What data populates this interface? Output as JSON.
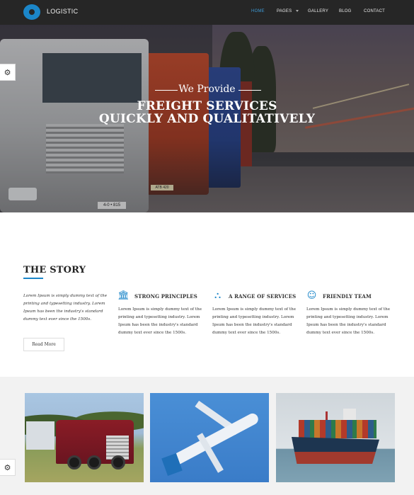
{
  "header": {
    "brand": "LOGISTIC",
    "logo_icon": "logo-ring-icon",
    "accent_color": "#1b86c9",
    "nav": [
      {
        "label": "HOME",
        "active": true
      },
      {
        "label": "PAGES",
        "active": false,
        "has_dropdown": true
      },
      {
        "label": "GALLERY",
        "active": false
      },
      {
        "label": "BLOG",
        "active": false
      },
      {
        "label": "CONTACT",
        "active": false
      }
    ]
  },
  "hero": {
    "kicker": "We Provide",
    "title_line1": "FREIGHT SERVICES",
    "title_line2": "QUICKLY AND QUALITATIVELY",
    "truck_plates": [
      "4-0 • 815",
      "ATB 420"
    ]
  },
  "settings": {
    "gear_icon": "⚙"
  },
  "story": {
    "title": "THE STORY",
    "intro": "Lorem Ipsum is simply dummy text of the printing and typesetting industry. Lorem Ipsum has been the industry's standard dummy text ever since the 1500s.",
    "read_more": "Read More",
    "features": [
      {
        "icon": "bank-icon",
        "glyph": "🏛",
        "title": "STRONG PRINCIPLES",
        "text": "Lorem Ipsum is simply dummy text of the printing and typesetting industry. Lorem Ipsum has been the industry's standard dummy text ever since the 1500s."
      },
      {
        "icon": "sitemap-icon",
        "glyph": "⛬",
        "title": "A RANGE OF SERVICES",
        "text": "Lorem Ipsum is simply dummy text of the printing and typesetting industry. Lorem Ipsum has been the industry's standard dummy text ever since the 1500s."
      },
      {
        "icon": "smile-icon",
        "glyph": "☺",
        "title": "FRIENDLY TEAM",
        "text": "Lorem Ipsum is simply dummy text of the printing and typesetting industry. Lorem Ipsum has been the industry's standard dummy text ever since the 1500s."
      }
    ]
  },
  "gallery": {
    "photos": [
      "truck-photo",
      "airplane-photo",
      "cargo-ship-photo"
    ]
  }
}
